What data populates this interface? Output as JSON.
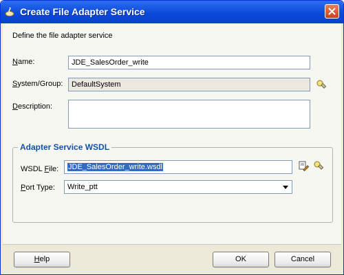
{
  "window": {
    "title": "Create File Adapter Service"
  },
  "intro": "Define the file adapter service",
  "fields": {
    "name": {
      "label_first": "N",
      "label_rest": "ame:",
      "value": "JDE_SalesOrder_write"
    },
    "system_group": {
      "label_first": "S",
      "label_rest": "ystem/Group:",
      "value": "DefaultSystem"
    },
    "description": {
      "label_first": "D",
      "label_rest": "escription:",
      "value": ""
    }
  },
  "wsdl_group": {
    "title": "Adapter Service WSDL",
    "wsdl_file": {
      "label_pre": "WSDL ",
      "label_first": "F",
      "label_rest": "ile:",
      "value": "JDE_SalesOrder_write.wsdl"
    },
    "port_type": {
      "label_first": "P",
      "label_rest": "ort Type:",
      "value": "Write_ptt"
    }
  },
  "buttons": {
    "help_first": "H",
    "help_rest": "elp",
    "ok": "OK",
    "cancel": "Cancel"
  },
  "icons": {
    "title": "dialog-app-icon",
    "close": "close-icon",
    "system_browse": "flashlight-icon",
    "wsdl_edit": "edit-document-icon",
    "wsdl_browse": "flashlight-icon",
    "dropdown": "chevron-down-icon"
  }
}
